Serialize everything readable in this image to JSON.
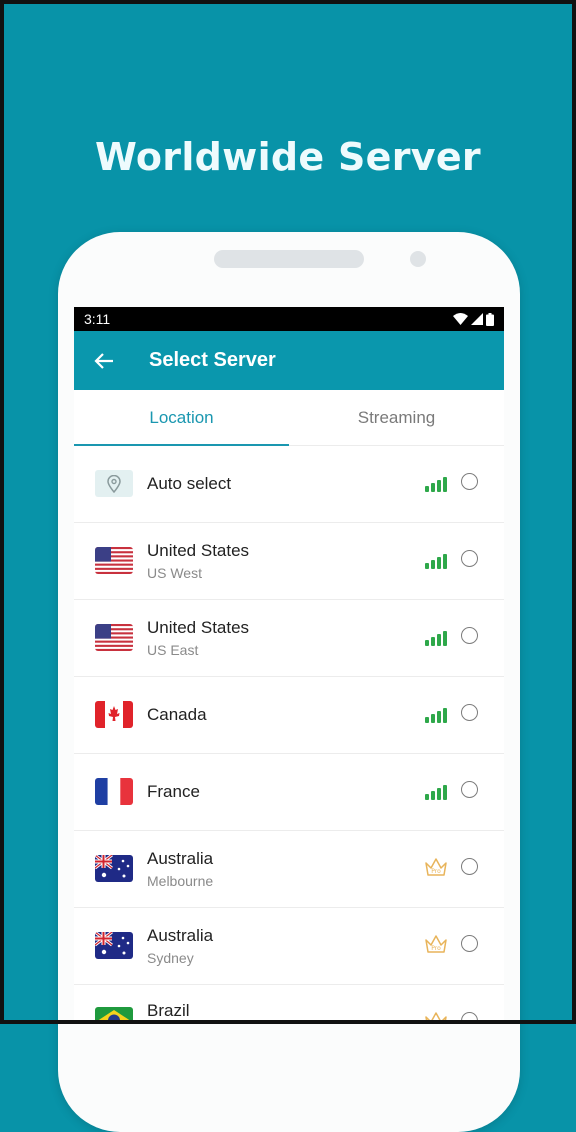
{
  "headline": "Worldwide Server",
  "status_bar": {
    "time": "3:11"
  },
  "app_bar": {
    "title": "Select Server"
  },
  "tabs": [
    {
      "label": "Location",
      "active": true
    },
    {
      "label": "Streaming",
      "active": false
    }
  ],
  "colors": {
    "accent": "#0a97ad",
    "signal": "#2ea84a",
    "pro": "#e8b45a",
    "background": "#0893a8"
  },
  "servers": [
    {
      "name": "Auto select",
      "sub": "",
      "icon": "location-pin-icon",
      "tier": "free"
    },
    {
      "name": "United States",
      "sub": "US West",
      "icon": "us-flag-icon",
      "tier": "free"
    },
    {
      "name": "United States",
      "sub": "US East",
      "icon": "us-flag-icon",
      "tier": "free"
    },
    {
      "name": "Canada",
      "sub": "",
      "icon": "canada-flag-icon",
      "tier": "free"
    },
    {
      "name": "France",
      "sub": "",
      "icon": "france-flag-icon",
      "tier": "free"
    },
    {
      "name": "Australia",
      "sub": "Melbourne",
      "icon": "australia-flag-icon",
      "tier": "pro"
    },
    {
      "name": "Australia",
      "sub": "Sydney",
      "icon": "australia-flag-icon",
      "tier": "pro"
    },
    {
      "name": "Brazil",
      "sub": "",
      "icon": "brazil-flag-icon",
      "tier": "pro"
    }
  ]
}
